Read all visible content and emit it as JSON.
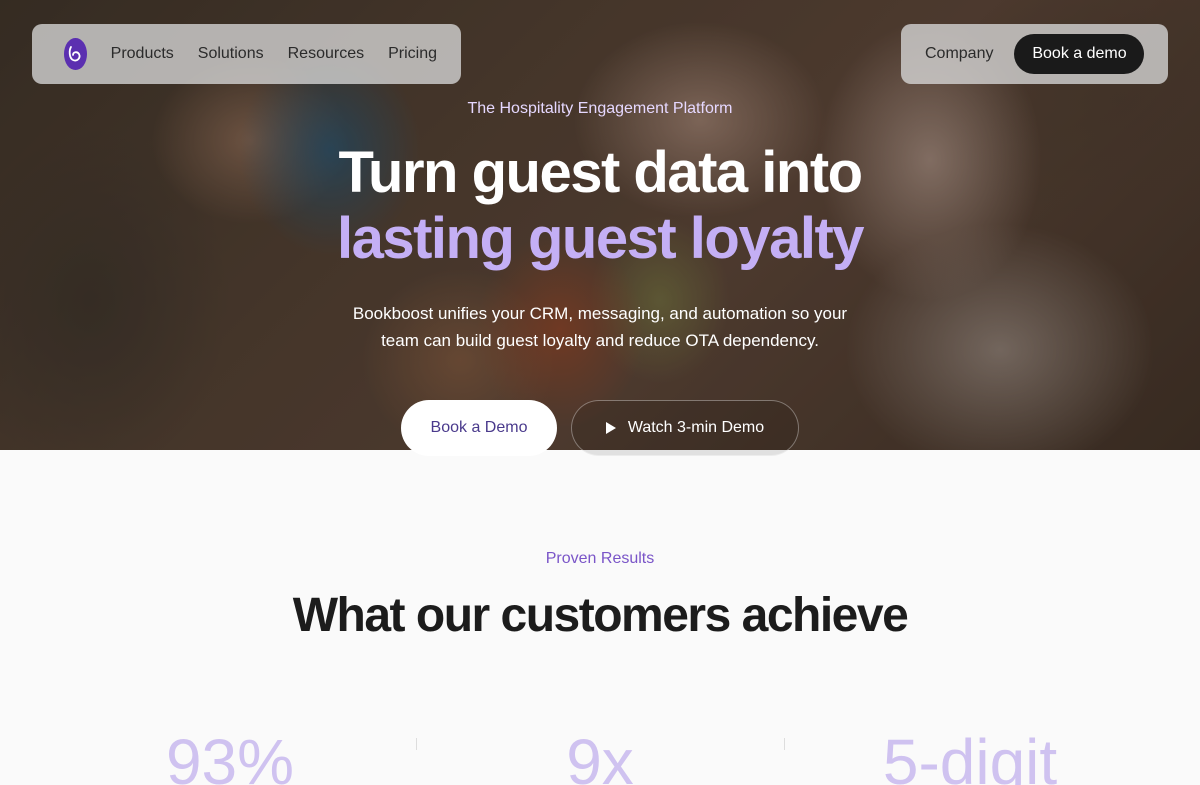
{
  "nav": {
    "primary": [
      "Products",
      "Solutions",
      "Resources",
      "Pricing"
    ],
    "company_label": "Company",
    "book_demo_label": "Book a demo"
  },
  "hero": {
    "eyebrow": "The Hospitality Engagement Platform",
    "headline_line1": "Turn guest data into",
    "headline_line2": "lasting guest loyalty",
    "subtext": "Bookboost unifies your CRM, messaging, and automation so your team can build guest loyalty and reduce OTA dependency.",
    "cta_primary": "Book a Demo",
    "cta_secondary": "Watch 3-min Demo"
  },
  "results": {
    "eyebrow": "Proven Results",
    "title": "What our customers achieve",
    "stats": [
      "93%",
      "9x",
      "5-digit"
    ]
  },
  "colors": {
    "accent_purple": "#7a55c8",
    "headline_accent": "#c4aff5",
    "logo": "#5b2fb0",
    "dark_button": "#1a1a1a"
  }
}
